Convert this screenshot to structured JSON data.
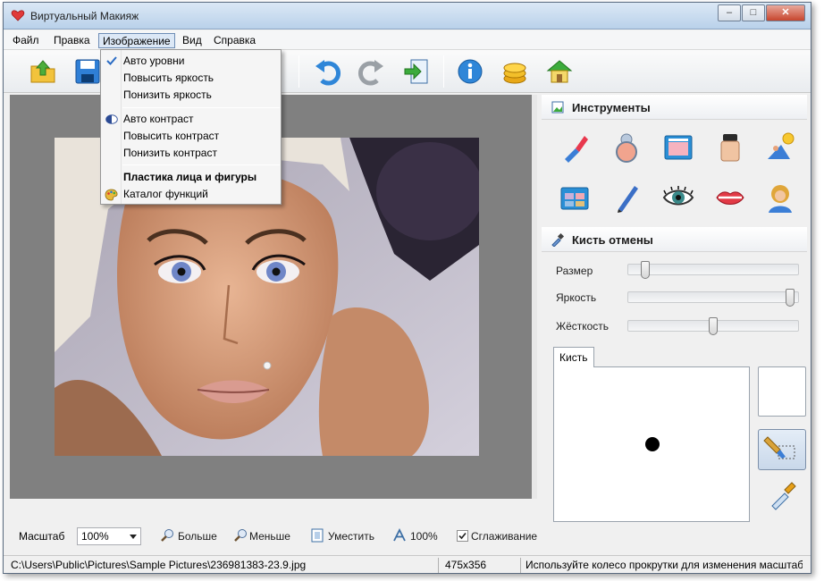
{
  "window": {
    "title": "Виртуальный Макияж"
  },
  "menu": {
    "items": [
      "Файл",
      "Правка",
      "Изображение",
      "Вид",
      "Справка"
    ],
    "active": "Изображение"
  },
  "dropdown": {
    "items": [
      {
        "label": "Авто уровни",
        "checked": true
      },
      {
        "label": "Повысить яркость"
      },
      {
        "label": "Понизить яркость"
      },
      {
        "label": "Авто контраст",
        "icon": "contrast-icon"
      },
      {
        "label": "Повысить контраст"
      },
      {
        "label": "Понизить контраст"
      },
      {
        "label": "Пластика лица и фигуры",
        "bold": true
      },
      {
        "label": "Каталог функций",
        "icon": "palette-icon"
      }
    ]
  },
  "toolbar": {
    "icons": [
      "open-icon",
      "save-icon",
      "undo-icon",
      "redo-icon",
      "export-icon",
      "info-icon",
      "coins-icon",
      "home-icon"
    ]
  },
  "panels": {
    "tools_title": "Инструменты",
    "tools": [
      "lipstick-icon",
      "powder-icon",
      "palette-box-icon",
      "foundation-icon",
      "sunbathing-icon",
      "eyeshadow-icon",
      "pencil-icon",
      "eye-icon",
      "lips-icon",
      "hair-icon"
    ],
    "brush_title": "Кисть отмены",
    "sliders": [
      {
        "label": "Размер",
        "value": 0.08
      },
      {
        "label": "Яркость",
        "value": 0.98
      },
      {
        "label": "Жёсткость",
        "value": 0.5
      }
    ],
    "brush_tab": "Кисть"
  },
  "zoom": {
    "label": "Масштаб",
    "value": "100%",
    "bigger": "Больше",
    "smaller": "Меньше",
    "fit": "Уместить",
    "actual": "100%",
    "smoothing": "Сглаживание",
    "smoothing_checked": true
  },
  "status": {
    "path": "C:\\Users\\Public\\Pictures\\Sample Pictures\\236981383-23.9.jpg",
    "size": "475x356",
    "hint": "Используйте колесо прокрутки для изменения масштаба"
  }
}
